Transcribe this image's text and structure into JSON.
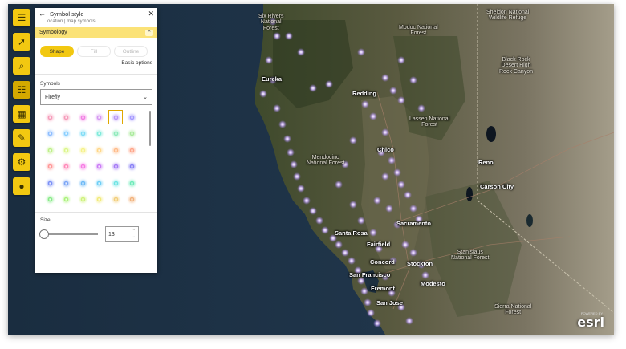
{
  "panel": {
    "title": "Symbol style",
    "breadcrumb": "… location | map symbols",
    "symbology_label": "Symbology",
    "tabs": [
      "Shape",
      "Fill",
      "Outline"
    ],
    "basic_options": "Basic options",
    "symbols_label": "Symbols",
    "symbol_set": "Firefly",
    "size_label": "Size",
    "size_value": "13",
    "swatch_colors": [
      [
        "#f48fb1",
        "#f48fb1",
        "#f06ee0",
        "#d08af0",
        "#b28cf5",
        "#9a8cff"
      ],
      [
        "#7fb5ff",
        "#7ac9ff",
        "#6fd8f5",
        "#6ee8d6",
        "#7fe8b2",
        "#a0e890"
      ],
      [
        "#b7ee7a",
        "#d7f57a",
        "#f5f07a",
        "#ffd27a",
        "#ffb37a",
        "#ff9a7a"
      ],
      [
        "#ff8a8a",
        "#ff7ab0",
        "#f56ae0",
        "#c46af5",
        "#9a6af5",
        "#7a70f5"
      ],
      [
        "#6a82f5",
        "#6a9af5",
        "#5ab0f5",
        "#5ac8f5",
        "#5ae0e0",
        "#5ae8b0"
      ],
      [
        "#7ae87a",
        "#a0f06a",
        "#c8f06a",
        "#f0e86a",
        "#f0c86a",
        "#f0a86a"
      ]
    ],
    "selected_swatch": "b28cf5"
  },
  "toolbar": {
    "icons": [
      "hamburger-menu-icon",
      "pointer-icon",
      "search-icon",
      "list-icon",
      "qr-grid-icon",
      "paintbrush-icon",
      "gear-icon",
      "user-icon"
    ]
  },
  "map": {
    "cities": [
      "Redding",
      "Eureka",
      "Chico",
      "Sacramento",
      "Santa Rosa",
      "Fairfield",
      "Concord",
      "Stockton",
      "San Francisco",
      "Fremont",
      "Modesto",
      "San Jose",
      "Reno",
      "Carson City"
    ],
    "regions": [
      "Six Rivers\nNational\nForest",
      "Modoc National\nForest",
      "Sheldon National\nWildlife Refuge",
      "Black Rock\nDesert High\nRock Canyon",
      "Lassen National\nForest",
      "Mendocino\nNational Forest",
      "Stanislaus\nNational Forest",
      "Sierra National\nForest"
    ],
    "logo": "esri",
    "glow_color": "#c8a8ff"
  }
}
